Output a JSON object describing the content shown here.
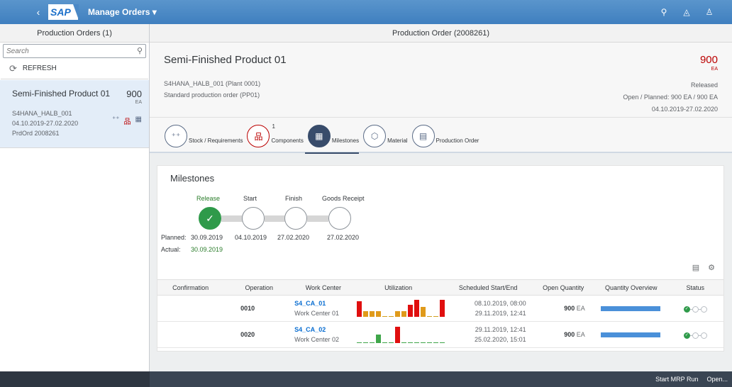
{
  "shell": {
    "back": "‹",
    "logo_text": "SAP",
    "app_title": "Manage Orders ▾",
    "search_icon": "⚲",
    "bell_icon": "🔔",
    "user_icon": "👤"
  },
  "master": {
    "header": "Production Orders (1)",
    "search_placeholder": "Search",
    "refresh_label": "REFRESH",
    "item": {
      "title": "Semi-Finished Product 01",
      "quantity": "900",
      "unit": "EA",
      "material": "S4HANA_HALB_001",
      "dates": "04.10.2019-27.02.2020",
      "order": "PrdOrd 2008261"
    }
  },
  "detail": {
    "header": "Production Order (2008261)",
    "title": "Semi-Finished Product 01",
    "quantity": "900",
    "unit": "EA",
    "attr1": "S4HANA_HALB_001 (Plant 0001)",
    "attr2": "Standard production order (PP01)",
    "status1": "Released",
    "status2": "Open / Planned: 900 EA / 900 EA",
    "status3": "04.10.2019-27.02.2020",
    "tabs": [
      {
        "label": "Stock / Requirements",
        "icon": "stock-icon"
      },
      {
        "label": "Components",
        "count": "1",
        "icon": "components-icon"
      },
      {
        "label": "Milestones",
        "icon": "milestones-icon"
      },
      {
        "label": "Material",
        "icon": "material-icon"
      },
      {
        "label": "Production Order",
        "icon": "document-icon"
      }
    ],
    "milestones": {
      "title": "Milestones",
      "labels": [
        "Release",
        "Start",
        "Finish",
        "Goods Receipt"
      ],
      "planned_label": "Planned:",
      "actual_label": "Actual:",
      "planned": [
        "30.09.2019",
        "04.10.2019",
        "27.02.2020",
        "27.02.2020"
      ],
      "actual": "30.09.2019"
    },
    "table": {
      "headers": [
        "Confirmation",
        "Operation",
        "Work Center",
        "Utilization",
        "Scheduled Start/End",
        "Open Quantity",
        "Quantity Overview",
        "Status"
      ],
      "rows": [
        {
          "operation": "0010",
          "wc": "S4_CA_01",
          "wc_sub": "Work Center 01",
          "start": "08.10.2019, 08:00",
          "end": "29.11.2019, 12:41",
          "qty": "900",
          "unit": "EA",
          "util": [
            0.9,
            0.35,
            0.35,
            0.35,
            0.05,
            0.05,
            0.35,
            0.35,
            0.7,
            1.0,
            0.6,
            0.05,
            0.05,
            1.0
          ]
        },
        {
          "operation": "0020",
          "wc": "S4_CA_02",
          "wc_sub": "Work Center 02",
          "start": "29.11.2019, 12:41",
          "end": "25.02.2020, 15:01",
          "qty": "900",
          "unit": "EA",
          "util": [
            0.05,
            0.05,
            0.05,
            0.5,
            0.05,
            0.05,
            0.95,
            0.05,
            0.05,
            0.05,
            0.05,
            0.05,
            0.05,
            0.05
          ]
        }
      ]
    }
  },
  "footer": {
    "mrp": "Start MRP Run",
    "open": "Open..."
  },
  "colors": {
    "shell": "#4a88c6",
    "accent": "#0a6ed1",
    "negative": "#bb0000",
    "positive": "#2f9a4a",
    "util_red": "#e00f0f",
    "util_orange": "#e09a1a",
    "util_green": "#3fa64a"
  }
}
